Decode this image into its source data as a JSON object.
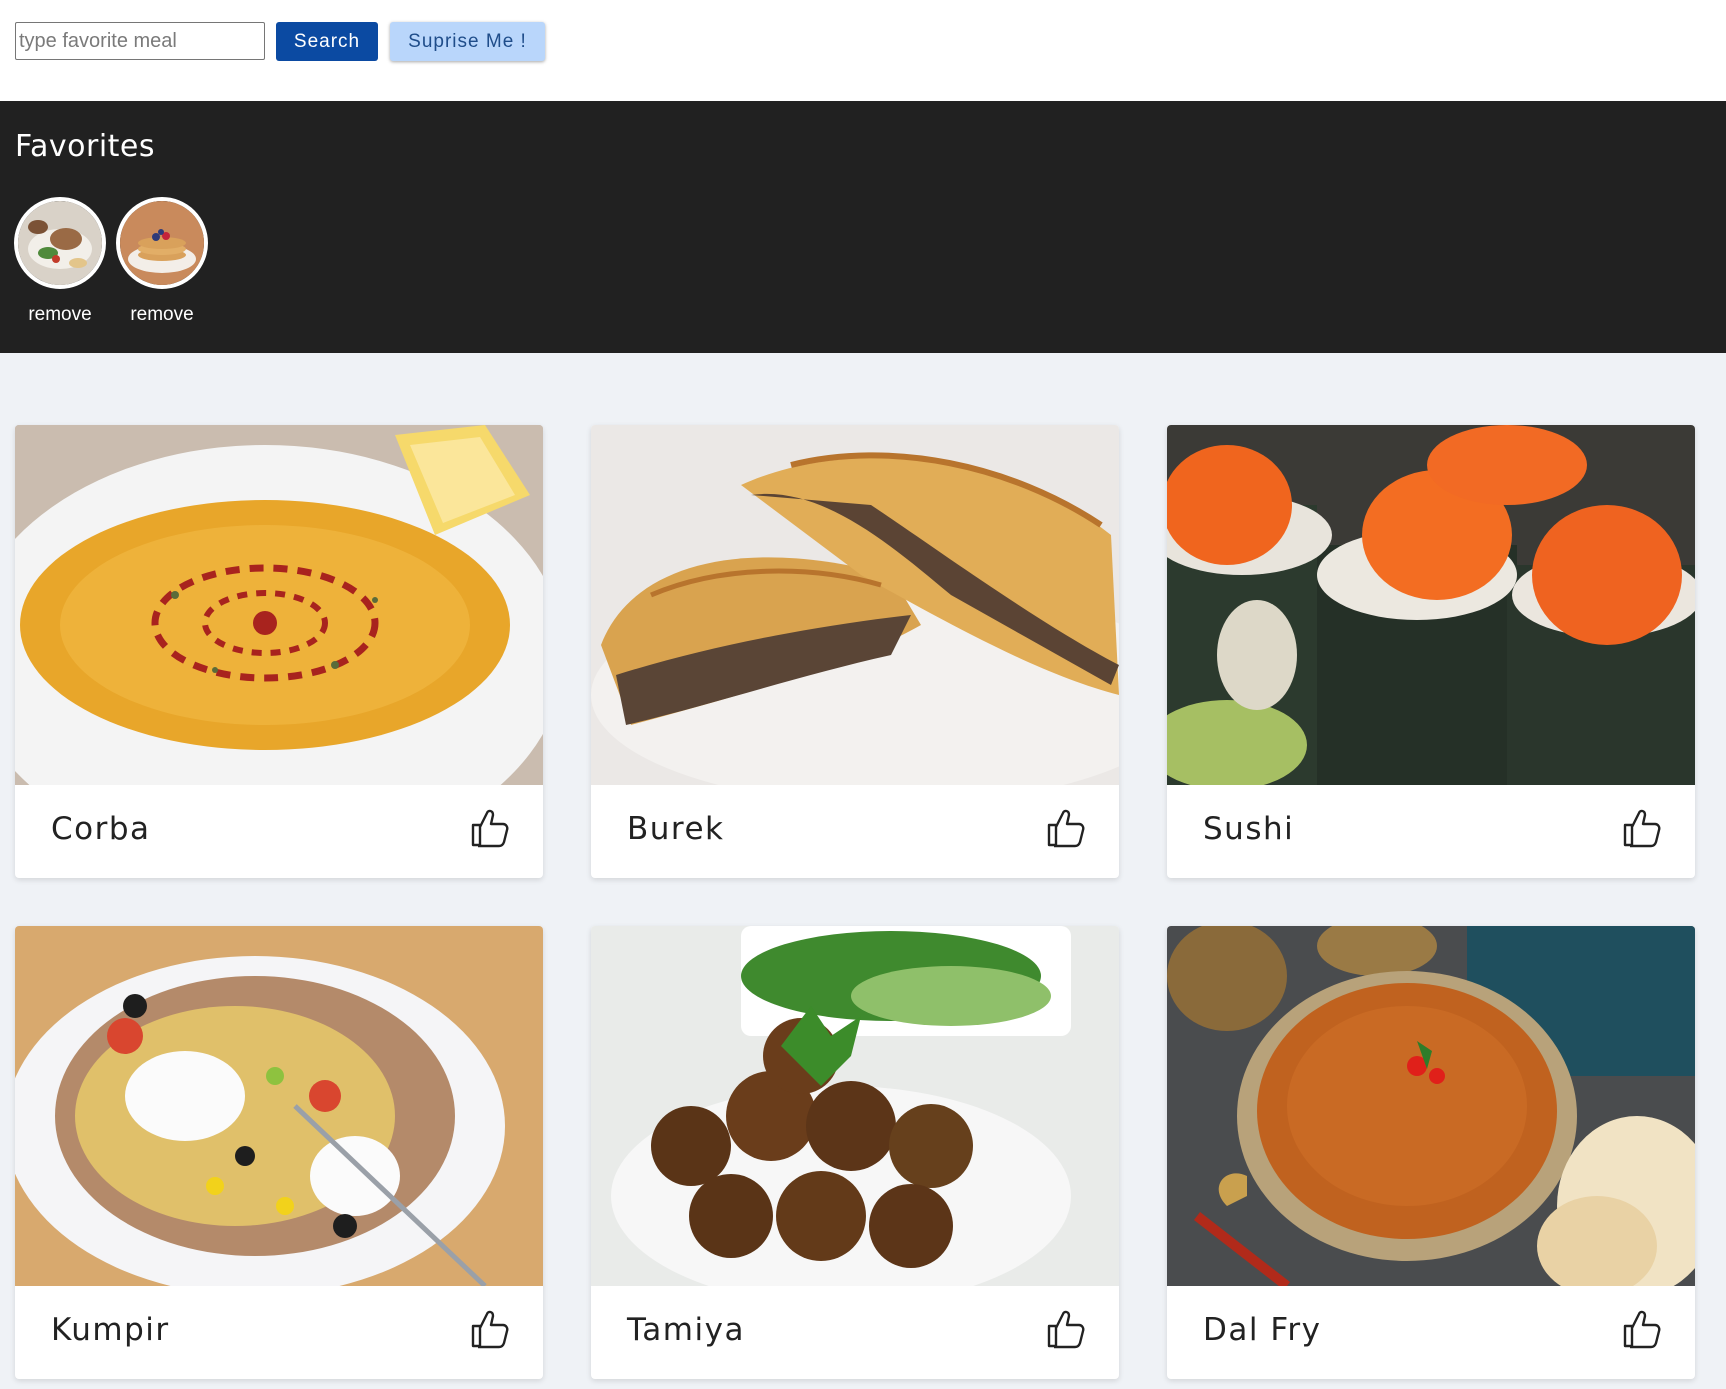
{
  "search": {
    "placeholder": "type favorite meal",
    "value": "",
    "search_label": "Search",
    "surprise_label": "Suprise Me !"
  },
  "favorites": {
    "title": "Favorites",
    "items": [
      {
        "remove_label": "remove",
        "image_icon": "meal-photo"
      },
      {
        "remove_label": "remove",
        "image_icon": "pancakes-photo"
      }
    ]
  },
  "meals": [
    {
      "name": "Corba",
      "image_icon": "soup-photo",
      "like_icon": "thumbs-up-icon"
    },
    {
      "name": "Burek",
      "image_icon": "burek-photo",
      "like_icon": "thumbs-up-icon"
    },
    {
      "name": "Sushi",
      "image_icon": "sushi-photo",
      "like_icon": "thumbs-up-icon"
    },
    {
      "name": "Kumpir",
      "image_icon": "kumpir-photo",
      "like_icon": "thumbs-up-icon"
    },
    {
      "name": "Tamiya",
      "image_icon": "falafel-photo",
      "like_icon": "thumbs-up-icon"
    },
    {
      "name": "Dal Fry",
      "image_icon": "dal-photo",
      "like_icon": "thumbs-up-icon"
    }
  ],
  "colors": {
    "primary_button": "#0b4aa2",
    "secondary_button": "#b9d6fb",
    "favorites_bg": "#212121",
    "page_bg": "#eff2f6"
  }
}
